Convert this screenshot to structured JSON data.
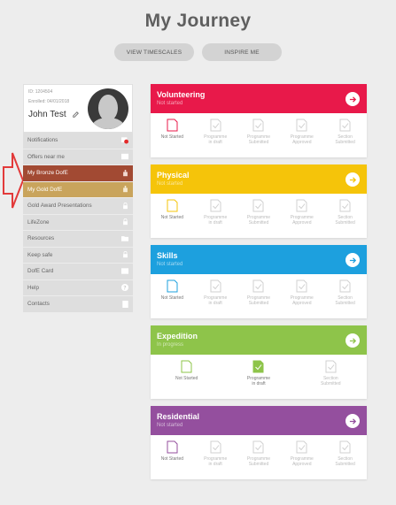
{
  "page": {
    "title": "My Journey"
  },
  "buttons": {
    "timescales": "VIEW TIMESCALES",
    "inspire": "INSPIRE ME"
  },
  "profile": {
    "id": "ID: 1204504",
    "enrolled": "Enrolled: 04/01/2018",
    "name": "John Test"
  },
  "menu": [
    {
      "label": "Notifications",
      "icon": "notification-badge-icon"
    },
    {
      "label": "Offers near me",
      "icon": "tag-icon"
    },
    {
      "label": "My Bronze DofE",
      "icon": "award-icon"
    },
    {
      "label": "My Gold DofE",
      "icon": "award-icon"
    },
    {
      "label": "Gold Award Presentations",
      "icon": "lock-icon"
    },
    {
      "label": "LifeZone",
      "icon": "lock-icon"
    },
    {
      "label": "Resources",
      "icon": "folder-icon"
    },
    {
      "label": "Keep safe",
      "icon": "lock-icon"
    },
    {
      "label": "DofE Card",
      "icon": "card-icon"
    },
    {
      "label": "Help",
      "icon": "help-icon"
    },
    {
      "label": "Contacts",
      "icon": "contacts-icon"
    }
  ],
  "sections": [
    {
      "name": "Volunteering",
      "status": "Not started",
      "color": "#e8194a",
      "steps": [
        "Not Started",
        "Programme\nin draft",
        "Programme\nSubmitted",
        "Programme\nApproved",
        "Section\nSubmitted"
      ]
    },
    {
      "name": "Physical",
      "status": "Not started",
      "color": "#f5c40a",
      "steps": [
        "Not Started",
        "Programme\nin draft",
        "Programme\nSubmitted",
        "Programme\nApproved",
        "Section\nSubmitted"
      ]
    },
    {
      "name": "Skills",
      "status": "Not started",
      "color": "#1da0de",
      "steps": [
        "Not Started",
        "Programme\nin draft",
        "Programme\nSubmitted",
        "Programme\nApproved",
        "Section\nSubmitted"
      ]
    },
    {
      "name": "Expedition",
      "status": "In progress",
      "color": "#8ec44a",
      "steps": [
        "Not Started",
        "Programme\nin draft",
        "Section\nSubmitted"
      ]
    },
    {
      "name": "Residential",
      "status": "Not started",
      "color": "#944f9e",
      "steps": [
        "Not Started",
        "Programme\nin draft",
        "Programme\nSubmitted",
        "Programme\nApproved",
        "Section\nSubmitted"
      ]
    }
  ]
}
